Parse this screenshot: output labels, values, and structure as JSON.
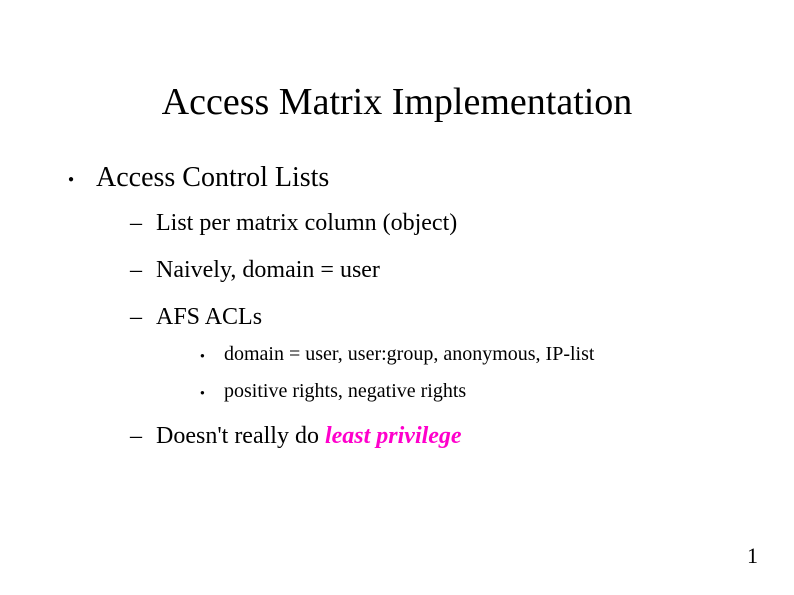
{
  "title": "Access Matrix Implementation",
  "bullets": {
    "main": "Access Control Lists",
    "subs": [
      "List per matrix column (object)",
      "Naively, domain = user",
      "AFS ACLs",
      "Doesn't really do "
    ],
    "afs": [
      "domain = user, user:group, anonymous, IP-list",
      "positive rights, negative rights"
    ],
    "emph": "least privilege"
  },
  "colors": {
    "emph": "#ff00cc"
  },
  "pageNumber": "1"
}
